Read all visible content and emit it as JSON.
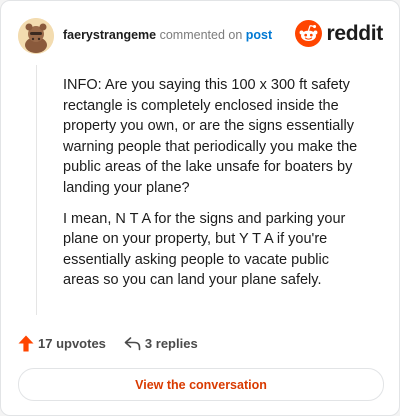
{
  "header": {
    "username": "faerystrangeme",
    "action_text": "commented on",
    "post_link": "post",
    "brand_name": "reddit"
  },
  "comment": {
    "paragraphs": [
      "INFO: Are you saying this 100 x 300 ft safety rectangle is completely enclosed inside the property you own, or are the signs essentially warning people that periodically you make the public areas of the lake unsafe for boaters by landing your plane?",
      "I mean, N T A for the signs and parking your plane on your property, but Y T A if you're essentially asking people to vacate public areas so you can land your plane safely."
    ]
  },
  "actions": {
    "upvotes": "17 upvotes",
    "replies": "3 replies"
  },
  "footer": {
    "view_button": "View the conversation"
  },
  "icons": {
    "avatar": "user-avatar",
    "brand": "reddit-logo-icon",
    "upvote": "upvote-arrow-icon",
    "reply": "reply-arrow-icon"
  },
  "colors": {
    "brand_orange": "#ff4500",
    "upvote_orange": "#ff4500",
    "link_blue": "#0079d3",
    "cta_text": "#d93a00"
  }
}
